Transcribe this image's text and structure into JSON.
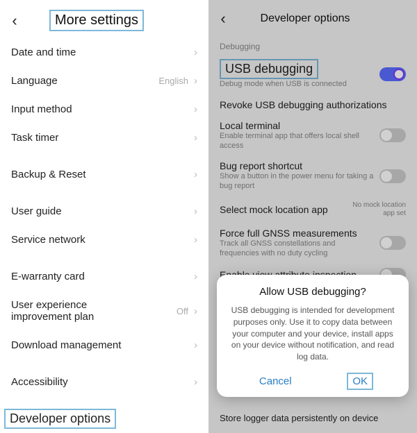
{
  "left": {
    "title": "More settings",
    "rows": [
      {
        "label": "Date and time"
      },
      {
        "label": "Language",
        "value": "English"
      },
      {
        "label": "Input method"
      },
      {
        "label": "Task timer"
      }
    ],
    "rows2": [
      {
        "label": "Backup & Reset"
      }
    ],
    "rows3": [
      {
        "label": "User guide"
      },
      {
        "label": "Service network"
      }
    ],
    "rows4": [
      {
        "label": "E-warranty card"
      },
      {
        "label": "User experience improvement plan",
        "value": "Off"
      },
      {
        "label": "Download management"
      }
    ],
    "rows5": [
      {
        "label": "Accessibility"
      }
    ],
    "developer_options": "Developer options"
  },
  "right": {
    "title": "Developer options",
    "section": "Debugging",
    "options": [
      {
        "label": "USB debugging",
        "sub": "Debug mode when USB is connected",
        "toggle": true
      },
      {
        "label": "Revoke USB debugging authorizations"
      },
      {
        "label": "Local terminal",
        "sub": "Enable terminal app that offers local shell access",
        "toggle": false
      },
      {
        "label": "Bug report shortcut",
        "sub": "Show a button in the power menu for taking a bug report",
        "toggle": false
      },
      {
        "label": "Select mock location app",
        "value": "No mock location app set"
      },
      {
        "label": "Force full GNSS measurements",
        "sub": "Track all GNSS constellations and frequencies with no duty cycling",
        "toggle": false
      },
      {
        "label": "Enable view attribute inspection",
        "toggle": false
      }
    ],
    "bottom": "Store logger data persistently on device",
    "dialog": {
      "title": "Allow USB debugging?",
      "body": "USB debugging is intended for development purposes only. Use it to copy data between your computer and your device, install apps on your device without notification, and read log data.",
      "cancel": "Cancel",
      "ok": "OK"
    }
  }
}
